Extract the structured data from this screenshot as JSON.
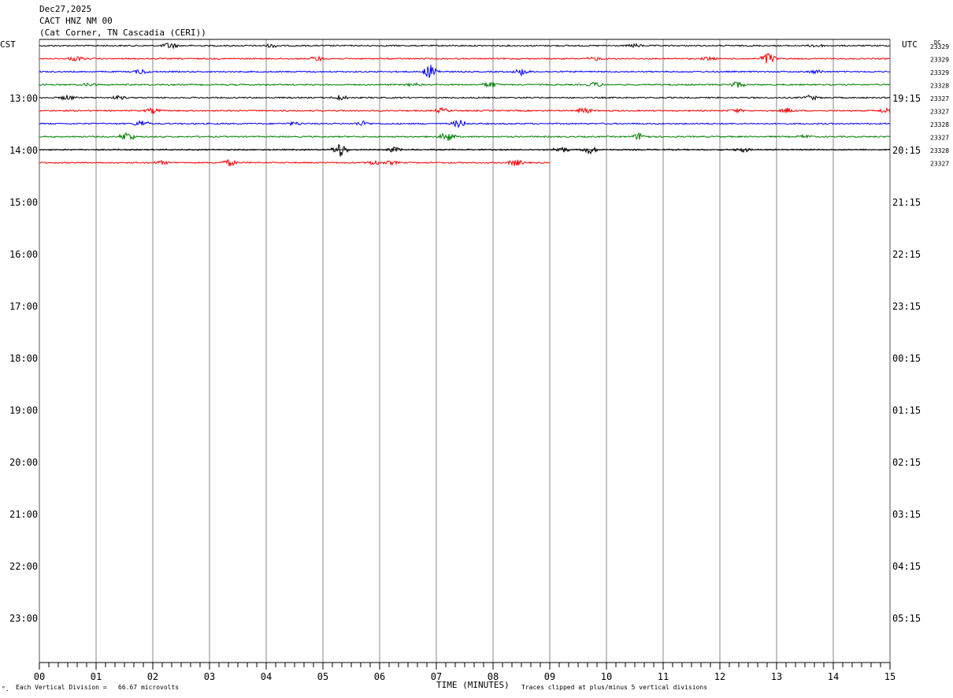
{
  "header": {
    "date": "Dec27,2025",
    "station": "CACT HNZ NM 00",
    "location": "(Cat Corner, TN Cascadia (CERI))"
  },
  "left_zone": "CST",
  "right_zone": "UTC",
  "dc_label": "DC",
  "footer": {
    "corner_mark": "°.",
    "vertical_division": "Each Vertical Division =   66.67 microvolts",
    "time_label": "TIME (MINUTES)",
    "clip_note": "Traces clipped at plus/minus 5 vertical divisions"
  },
  "chart_data": {
    "type": "line",
    "title": "",
    "xlabel": "TIME (MINUTES)",
    "xlim": [
      0,
      15
    ],
    "x_ticks": [
      "00",
      "01",
      "02",
      "03",
      "04",
      "05",
      "06",
      "07",
      "08",
      "09",
      "10",
      "11",
      "12",
      "13",
      "14",
      "15"
    ],
    "left_hour_labels": [
      "13:00",
      "14:00",
      "15:00",
      "16:00",
      "17:00",
      "18:00",
      "19:00",
      "20:00",
      "21:00",
      "22:00",
      "23:00"
    ],
    "right_hour_labels": [
      "19:15",
      "20:15",
      "21:15",
      "22:15",
      "23:15",
      "00:15",
      "01:15",
      "02:15",
      "03:15",
      "04:15",
      "05:15"
    ],
    "colors": [
      "#000000",
      "#ff0000",
      "#0000ff",
      "#008000"
    ],
    "traces": [
      {
        "row": 0,
        "color": "#000000",
        "dc": "23329",
        "end_minute": 15,
        "events": [
          [
            2.3,
            4
          ],
          [
            4.1,
            2
          ],
          [
            10.5,
            2
          ],
          [
            13.7,
            2
          ]
        ]
      },
      {
        "row": 1,
        "color": "#ff0000",
        "dc": "23329",
        "end_minute": 15,
        "events": [
          [
            0.65,
            3
          ],
          [
            4.9,
            3
          ],
          [
            9.8,
            2
          ],
          [
            11.8,
            2
          ],
          [
            12.85,
            8
          ]
        ]
      },
      {
        "row": 2,
        "color": "#0000ff",
        "dc": "23329",
        "end_minute": 15,
        "events": [
          [
            1.8,
            3
          ],
          [
            6.9,
            9
          ],
          [
            8.5,
            4
          ],
          [
            13.7,
            2
          ]
        ]
      },
      {
        "row": 3,
        "color": "#008000",
        "dc": "23328",
        "end_minute": 15,
        "events": [
          [
            0.9,
            2
          ],
          [
            6.6,
            2
          ],
          [
            7.95,
            4
          ],
          [
            9.8,
            3
          ],
          [
            12.3,
            4
          ]
        ]
      },
      {
        "row": 4,
        "color": "#000000",
        "dc": "23327",
        "end_minute": 15,
        "events": [
          [
            0.5,
            3
          ],
          [
            1.4,
            2
          ],
          [
            5.3,
            3
          ],
          [
            13.6,
            3
          ]
        ]
      },
      {
        "row": 5,
        "color": "#ff0000",
        "dc": "23327",
        "end_minute": 15,
        "events": [
          [
            2.0,
            3
          ],
          [
            7.1,
            3
          ],
          [
            9.6,
            4
          ],
          [
            12.3,
            2
          ],
          [
            13.2,
            3
          ],
          [
            14.95,
            4
          ]
        ]
      },
      {
        "row": 6,
        "color": "#0000ff",
        "dc": "23328",
        "end_minute": 15,
        "events": [
          [
            1.8,
            4
          ],
          [
            5.7,
            3
          ],
          [
            7.4,
            5
          ],
          [
            4.5,
            2
          ]
        ]
      },
      {
        "row": 7,
        "color": "#008000",
        "dc": "23327",
        "end_minute": 15,
        "events": [
          [
            1.55,
            6
          ],
          [
            7.2,
            6
          ],
          [
            10.6,
            5
          ],
          [
            13.5,
            2
          ]
        ]
      },
      {
        "row": 8,
        "color": "#000000",
        "dc": "23328",
        "end_minute": 15,
        "events": [
          [
            5.3,
            9
          ],
          [
            6.25,
            3
          ],
          [
            9.2,
            4
          ],
          [
            9.7,
            5
          ],
          [
            12.4,
            3
          ]
        ]
      },
      {
        "row": 9,
        "color": "#ff0000",
        "dc": "23327",
        "end_minute": 9,
        "events": [
          [
            2.15,
            2
          ],
          [
            3.35,
            4
          ],
          [
            5.9,
            3
          ],
          [
            6.2,
            2
          ],
          [
            8.4,
            4
          ]
        ]
      }
    ]
  }
}
